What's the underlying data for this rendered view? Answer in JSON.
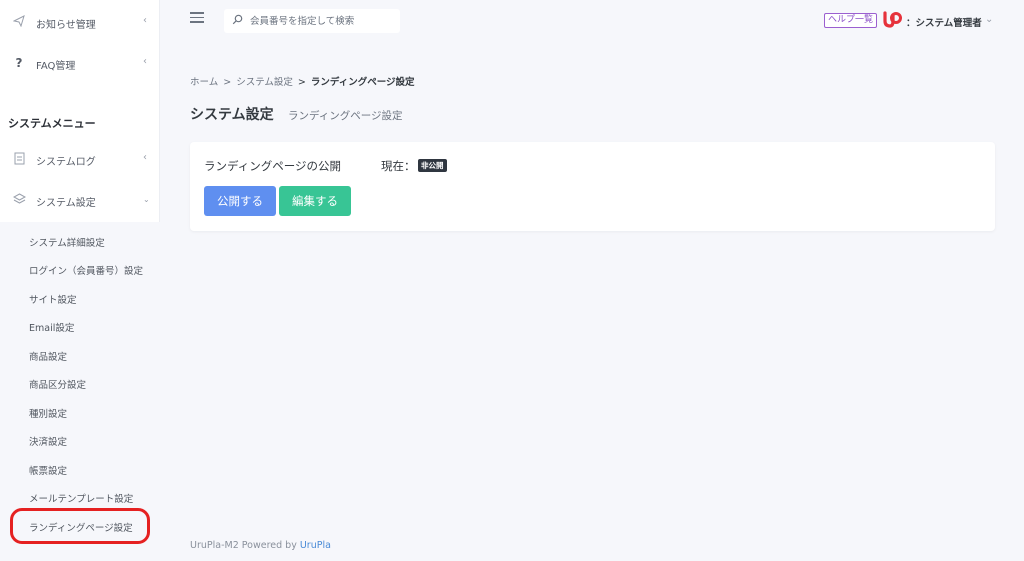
{
  "sidebar": {
    "items_top": [
      {
        "label": "お知らせ管理",
        "icon": "paper-plane-icon"
      },
      {
        "label": "FAQ管理",
        "icon": "question-icon"
      }
    ],
    "section_title": "システムメニュー",
    "items_system": [
      {
        "label": "システムログ",
        "icon": "document-icon"
      },
      {
        "label": "システム設定",
        "icon": "layers-icon"
      }
    ],
    "submenu": [
      "システム詳細設定",
      "ログイン（会員番号）設定",
      "サイト設定",
      "Email設定",
      "商品設定",
      "商品区分設定",
      "種別設定",
      "決済設定",
      "帳票設定",
      "メールテンプレート設定",
      "ランディングページ設定"
    ]
  },
  "topbar": {
    "search_placeholder": "会員番号を指定して検索",
    "help_label": "ヘルプ一覧",
    "user_name": "：システム管理者"
  },
  "breadcrumb": {
    "home": "ホーム",
    "parent": "システム設定",
    "current": "ランディングページ設定",
    "separator": ">"
  },
  "page": {
    "title": "システム設定",
    "subtitle": "ランディングページ設定"
  },
  "card": {
    "title": "ランディングページの公開",
    "status_label": "現在：",
    "status_badge": "非公開",
    "publish_button": "公開する",
    "edit_button": "編集する"
  },
  "footer": {
    "text": "UruPla-M2 Powered by ",
    "link": "UruPla"
  },
  "colors": {
    "publish_button": "#5f8ff0",
    "edit_button": "#38c595",
    "highlight_ring": "#e52121",
    "help_border": "#9b5fd0"
  }
}
